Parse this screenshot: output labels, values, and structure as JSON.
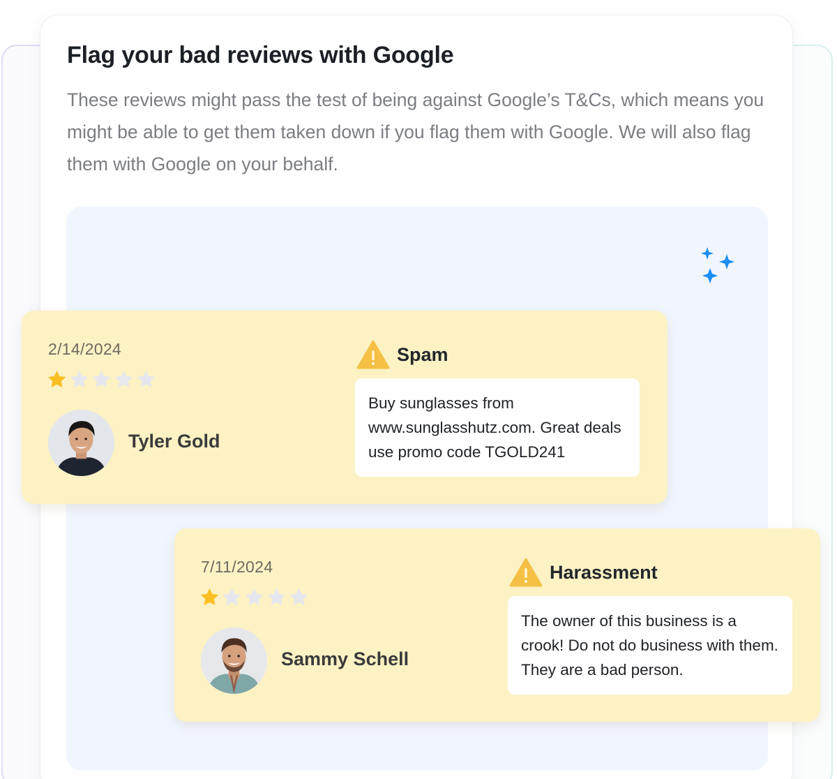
{
  "section": {
    "title": "Flag your bad reviews with Google",
    "description": "These reviews might pass the test of being against Google’s T&Cs, which means you might be able to get them taken down if you flag them with Google. We will also flag them with Google on your behalf."
  },
  "colors": {
    "card_background": "#fdf2c4",
    "panel_background": "#f1f6fe",
    "star_filled": "#fbbf24",
    "star_empty": "#e6e7ee",
    "warning": "#f5c044",
    "sparkle": "#1a8ef3"
  },
  "icons": {
    "sparkle": "sparkles-icon",
    "flag": "warning-triangle-icon",
    "star": "star-icon"
  },
  "reviews": [
    {
      "date": "2/14/2024",
      "rating": 1,
      "max_rating": 5,
      "author": "Tyler Gold",
      "flag_reason": "Spam",
      "text": "Buy sunglasses from www.sunglasshutz.com. Great deals use promo code TGOLD241"
    },
    {
      "date": "7/11/2024",
      "rating": 1,
      "max_rating": 5,
      "author": "Sammy Schell",
      "flag_reason": "Harassment",
      "text": "The owner of this business is a crook! Do not do business with them. They are a bad person."
    }
  ]
}
